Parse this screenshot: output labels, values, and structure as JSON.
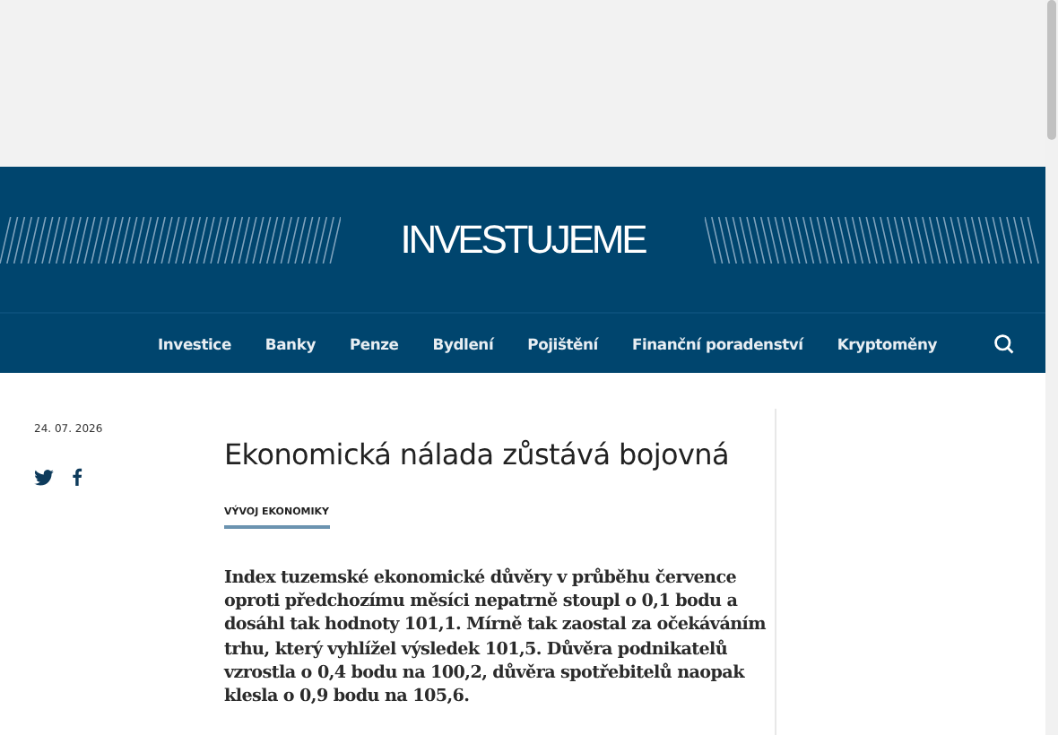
{
  "logo": "INVESTUJEME",
  "nav": [
    "Investice",
    "Banky",
    "Penze",
    "Bydlení",
    "Pojištění",
    "Finanční poradenství",
    "Kryptoměny"
  ],
  "article": {
    "date": "24. 07. 2026",
    "title": "Ekonomická nálada zůstává bojovná",
    "category": "VÝVOJ EKONOMIKY",
    "lead": "Index tuzemské ekonomické důvěry v průběhu července oproti předchozímu měsíci nepatrně stoupl o 0,1 bodu a dosáhl tak hodnoty 101,1. Mírně tak zaostal za očekáváním trhu, který vyhlížel výsledek 101,5. Důvěra podnikatelů vzrostla o 0,4 bodu na 100,2, důvěra spotřebitelů naopak klesla o 0,9 bodu na 105,6."
  }
}
